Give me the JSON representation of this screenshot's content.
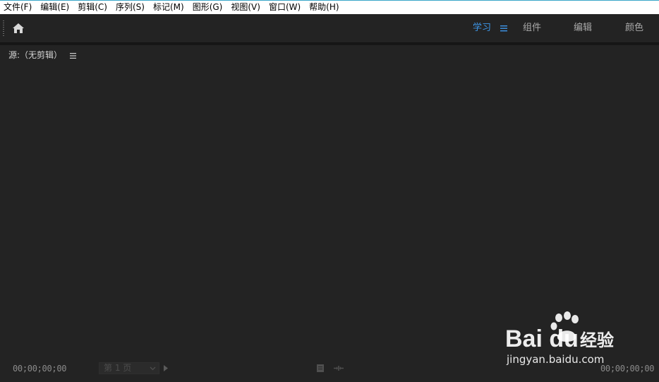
{
  "menubar": {
    "items": [
      "文件(F)",
      "编辑(E)",
      "剪辑(C)",
      "序列(S)",
      "标记(M)",
      "图形(G)",
      "视图(V)",
      "窗口(W)",
      "帮助(H)"
    ]
  },
  "header": {
    "home_icon": "home-icon",
    "workspaces": [
      "学习",
      "组件",
      "编辑",
      "颜色"
    ],
    "active_workspace": "学习",
    "menu_icon": "hamburger-menu-icon"
  },
  "panel": {
    "title": "源:（无剪辑）",
    "menu_icon": "hamburger-menu-icon"
  },
  "controls": {
    "timecode_left": "00;00;00;00",
    "page_select_value": "第 1 页",
    "timecode_right": "00;00;00;00"
  },
  "watermark": {
    "brand": "Bai du",
    "brand_suffix": "经验",
    "url": "jingyan.baidu.com"
  },
  "colors": {
    "background": "#232323",
    "active_tab": "#3d96e8",
    "menubar": "#ffffff",
    "accent_line": "#3aa7c9"
  }
}
